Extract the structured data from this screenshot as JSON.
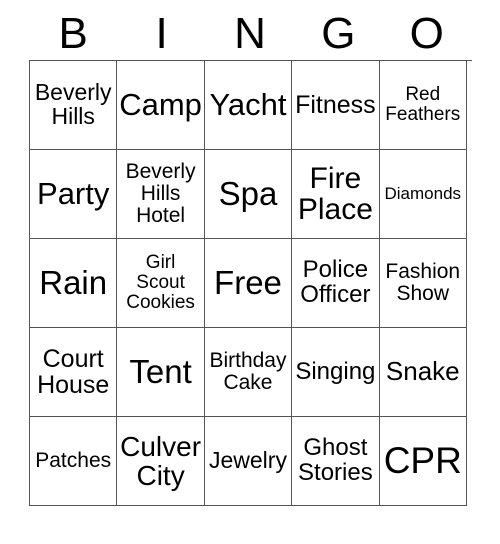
{
  "card": {
    "headers": [
      "B",
      "I",
      "N",
      "G",
      "O"
    ],
    "rows": [
      [
        {
          "label": "Beverly\nHills",
          "size": 23
        },
        {
          "label": "Camp",
          "size": 31
        },
        {
          "label": "Yacht",
          "size": 31
        },
        {
          "label": "Fitness",
          "size": 25
        },
        {
          "label": "Red\nFeathers",
          "size": 19
        }
      ],
      [
        {
          "label": "Party",
          "size": 31
        },
        {
          "label": "Beverly\nHills\nHotel",
          "size": 21
        },
        {
          "label": "Spa",
          "size": 33
        },
        {
          "label": "Fire\nPlace",
          "size": 30
        },
        {
          "label": "Diamonds",
          "size": 17
        }
      ],
      [
        {
          "label": "Rain",
          "size": 33
        },
        {
          "label": "Girl\nScout\nCookies",
          "size": 19
        },
        {
          "label": "Free",
          "size": 33
        },
        {
          "label": "Police\nOfficer",
          "size": 24
        },
        {
          "label": "Fashion\nShow",
          "size": 21
        }
      ],
      [
        {
          "label": "Court\nHouse",
          "size": 25
        },
        {
          "label": "Tent",
          "size": 33
        },
        {
          "label": "Birthday\nCake",
          "size": 21
        },
        {
          "label": "Singing",
          "size": 24
        },
        {
          "label": "Snake",
          "size": 26
        }
      ],
      [
        {
          "label": "Patches",
          "size": 21
        },
        {
          "label": "Culver\nCity",
          "size": 28
        },
        {
          "label": "Jewelry",
          "size": 23
        },
        {
          "label": "Ghost\nStories",
          "size": 24
        },
        {
          "label": "CPR",
          "size": 37
        }
      ]
    ]
  },
  "colors": {
    "border": "#555555",
    "text": "#000000",
    "background": "#ffffff"
  }
}
